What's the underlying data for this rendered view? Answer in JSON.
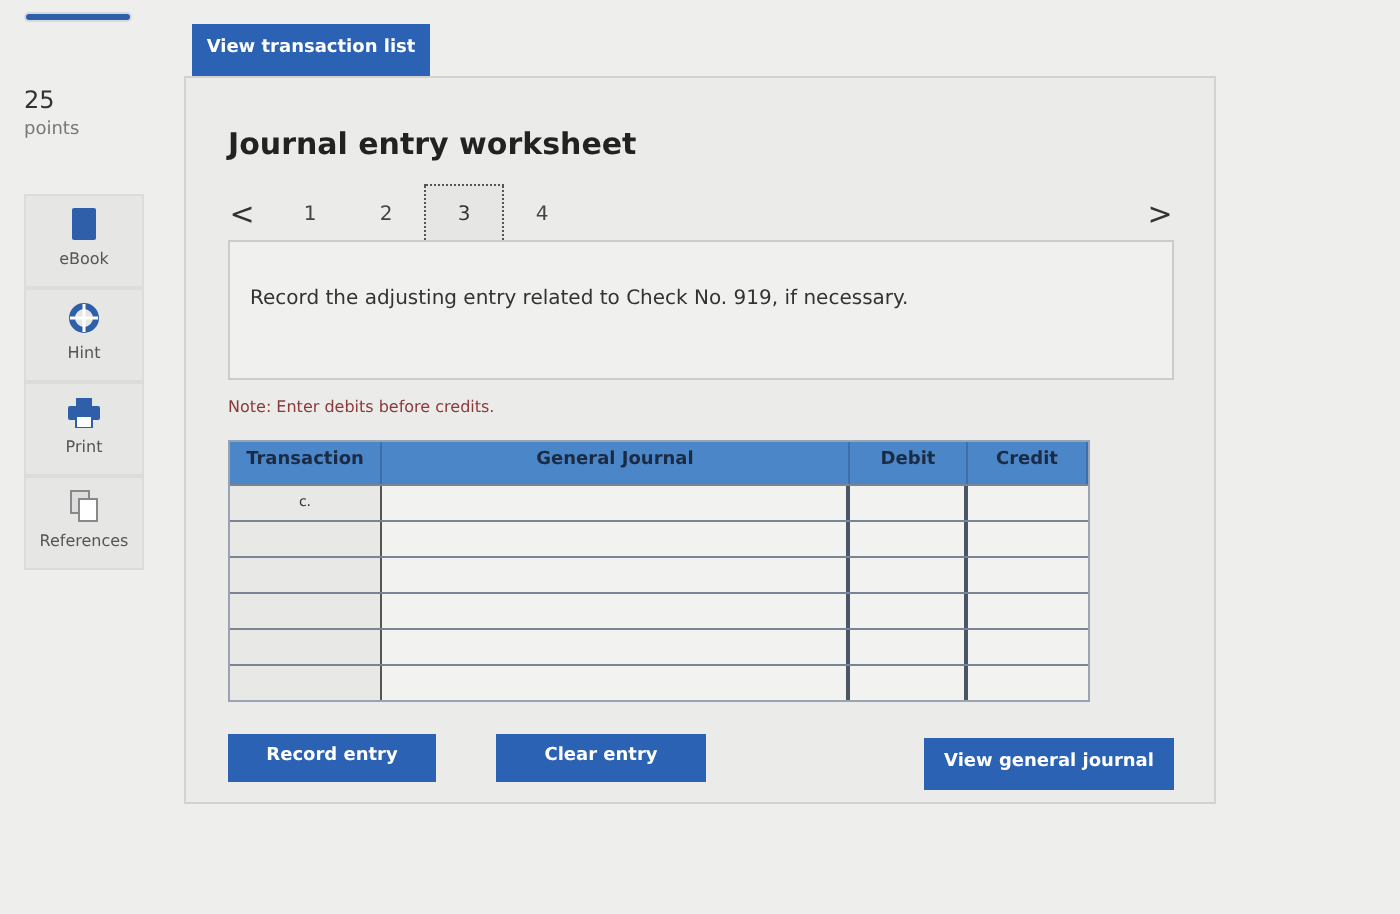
{
  "progress": {
    "level": 1
  },
  "top_button": "View transaction list",
  "score": {
    "value": "25",
    "unit": "points"
  },
  "tools": [
    {
      "kind": "ebook",
      "label": "eBook"
    },
    {
      "kind": "hint",
      "label": "Hint"
    },
    {
      "kind": "print",
      "label": "Print"
    },
    {
      "kind": "references",
      "label": "References"
    }
  ],
  "worksheet": {
    "title": "Journal entry worksheet",
    "prev": "<",
    "next": ">",
    "pages": [
      {
        "label": "1",
        "selected": false
      },
      {
        "label": "2",
        "selected": false
      },
      {
        "label": "3",
        "selected": true
      },
      {
        "label": "4",
        "selected": false
      }
    ],
    "instruction": "Record the adjusting entry related to Check No. 919, if necessary.",
    "note": "Note: Enter debits before credits.",
    "table": {
      "columns": [
        "Transaction",
        "General Journal",
        "Debit",
        "Credit"
      ],
      "rows": [
        {
          "transaction": "c."
        },
        {},
        {},
        {},
        {},
        {}
      ]
    },
    "buttons": [
      "Record entry",
      "Clear entry",
      "View general journal"
    ]
  }
}
